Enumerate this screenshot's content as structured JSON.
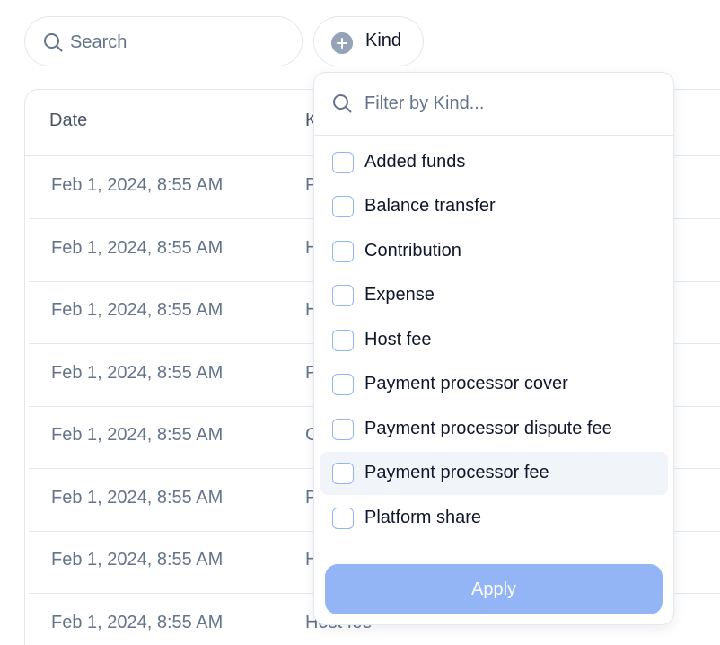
{
  "search": {
    "placeholder": "Search",
    "value": ""
  },
  "kind_button": {
    "label": "Kind",
    "icon": "plus-circle-icon"
  },
  "table": {
    "headers": {
      "date": "Date",
      "kind": "K"
    },
    "rows": [
      {
        "date": "Feb 1, 2024, 8:55 AM",
        "kind": "P"
      },
      {
        "date": "Feb 1, 2024, 8:55 AM",
        "kind": "H"
      },
      {
        "date": "Feb 1, 2024, 8:55 AM",
        "kind": "H"
      },
      {
        "date": "Feb 1, 2024, 8:55 AM",
        "kind": "P"
      },
      {
        "date": "Feb 1, 2024, 8:55 AM",
        "kind": "C"
      },
      {
        "date": "Feb 1, 2024, 8:55 AM",
        "kind": "P"
      },
      {
        "date": "Feb 1, 2024, 8:55 AM",
        "kind": "H"
      },
      {
        "date": "Feb 1, 2024, 8:55 AM",
        "kind": "Host fee"
      }
    ]
  },
  "dropdown": {
    "filter_placeholder": "Filter by Kind...",
    "options": [
      {
        "label": "Added funds",
        "checked": false
      },
      {
        "label": "Balance transfer",
        "checked": false
      },
      {
        "label": "Contribution",
        "checked": false
      },
      {
        "label": "Expense",
        "checked": false
      },
      {
        "label": "Host fee",
        "checked": false
      },
      {
        "label": "Payment processor cover",
        "checked": false
      },
      {
        "label": "Payment processor dispute fee",
        "checked": false
      },
      {
        "label": "Payment processor fee",
        "checked": false,
        "highlighted": true
      },
      {
        "label": "Platform share",
        "checked": false
      }
    ],
    "apply_label": "Apply"
  },
  "colors": {
    "border": "#e2e8f0",
    "muted_text": "#64748b",
    "apply_disabled": "#93b4f5",
    "highlight_row": "#f1f5f9"
  }
}
